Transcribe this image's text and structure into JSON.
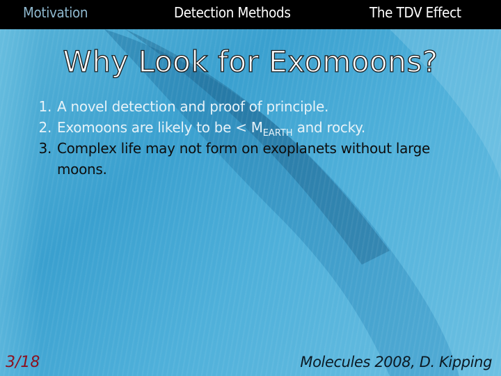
{
  "nav": {
    "items": [
      {
        "label": "Motivation",
        "active": true
      },
      {
        "label": "Detection Methods",
        "active": false
      },
      {
        "label": "The TDV Effect",
        "active": false
      }
    ]
  },
  "slide": {
    "title": "Why Look for Exomoons?",
    "points": [
      {
        "number": "1.",
        "text": "A novel detection and proof of principle."
      },
      {
        "number": "2.",
        "text_before": "Exomoons are likely to be < M",
        "subscript": "EARTH",
        "text_after": " and rocky."
      },
      {
        "number": "3.",
        "text_line1": "Complex life may not form on exoplanets without large",
        "text_line2": "moons."
      }
    ]
  },
  "footer": {
    "page_number": "3/18",
    "credit": "Molecules 2008, D. Kipping"
  },
  "colors": {
    "nav_bg": "#000000",
    "nav_active": "#8fb9cf",
    "nav_text": "#ffffff",
    "page_number": "#8b1220",
    "background": "#3aa0cf"
  }
}
